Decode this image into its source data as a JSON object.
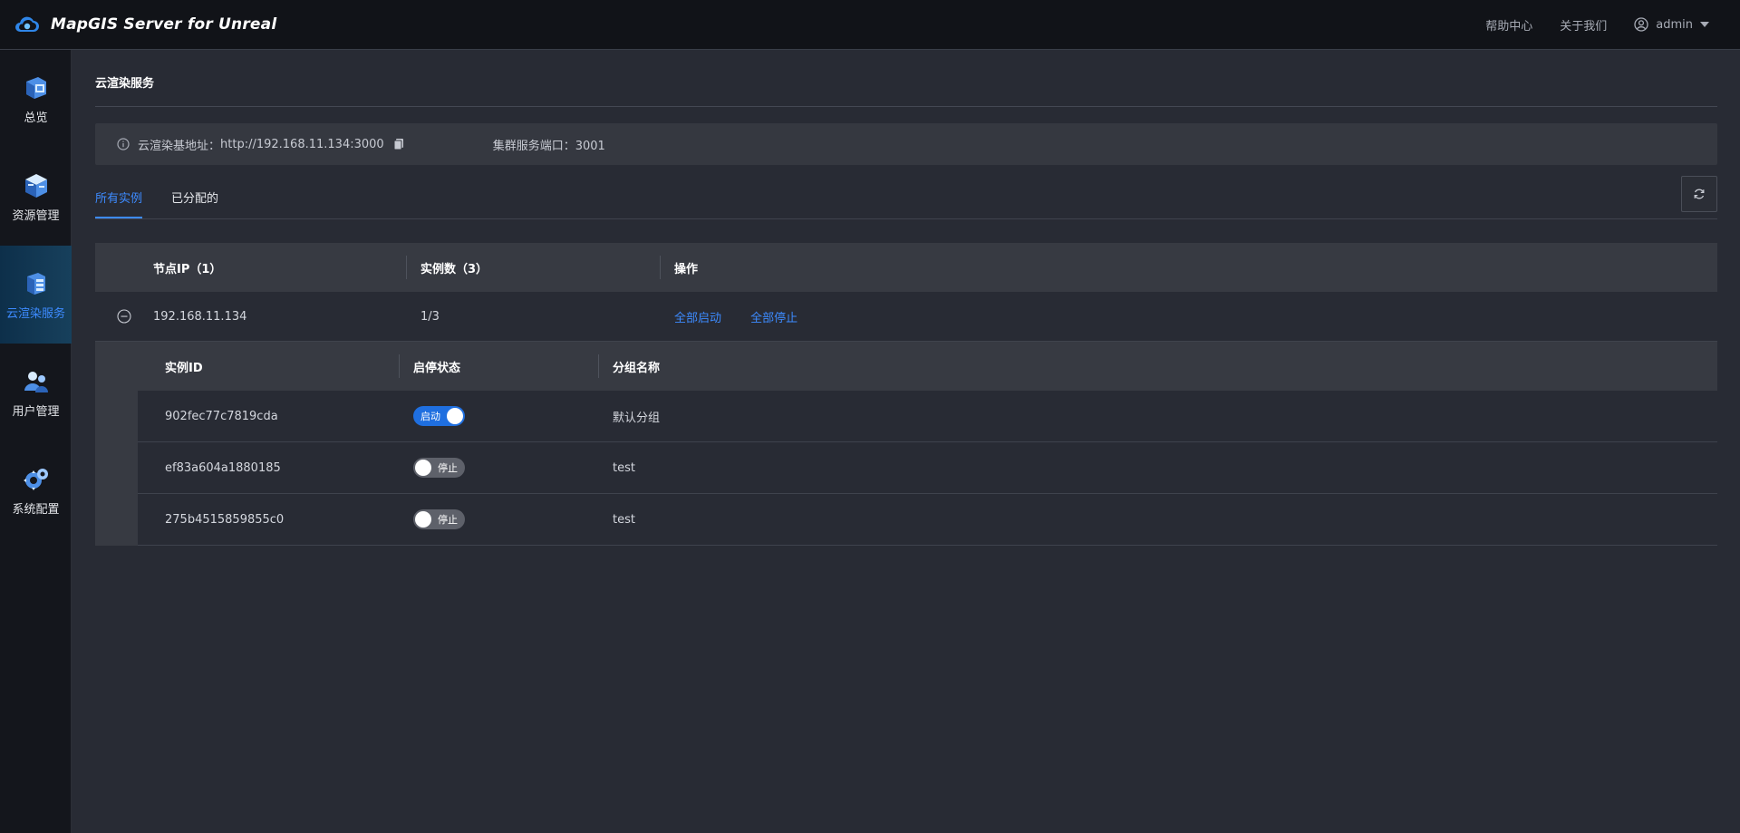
{
  "header": {
    "app_title": "MapGIS Server for Unreal",
    "links": [
      "帮助中心",
      "关于我们"
    ],
    "user": "admin"
  },
  "sidebar": {
    "items": [
      {
        "label": "总览",
        "icon": "overview-icon"
      },
      {
        "label": "资源管理",
        "icon": "resource-icon"
      },
      {
        "label": "云渲染服务",
        "icon": "cloud-render-icon",
        "active": true
      },
      {
        "label": "用户管理",
        "icon": "user-management-icon"
      },
      {
        "label": "系统配置",
        "icon": "system-config-icon"
      }
    ]
  },
  "page": {
    "title": "云渲染服务",
    "base_address_label": "云渲染基地址：",
    "base_address": "http://192.168.11.134:3000",
    "cluster_port_label": "集群服务端口：",
    "cluster_port": "3001"
  },
  "tabs": [
    {
      "label": "所有实例",
      "active": true
    },
    {
      "label": "已分配的",
      "active": false
    }
  ],
  "table": {
    "headers": {
      "node_ip": "节点IP（1）",
      "instance_count": "实例数（3）",
      "actions": "操作"
    },
    "node": {
      "ip": "192.168.11.134",
      "instances": "1/3",
      "start_all": "全部启动",
      "stop_all": "全部停止"
    },
    "sub_headers": {
      "instance_id": "实例ID",
      "status": "启停状态",
      "group_name": "分组名称"
    },
    "instances": [
      {
        "id": "902fec77c7819cda",
        "status": "启动",
        "on": true,
        "group": "默认分组"
      },
      {
        "id": "ef83a604a1880185",
        "status": "停止",
        "on": false,
        "group": "test"
      },
      {
        "id": "275b4515859855c0",
        "status": "停止",
        "on": false,
        "group": "test"
      }
    ]
  },
  "colors": {
    "accent": "#3d8bff",
    "switch_on": "#1f6fe0",
    "switch_off": "#5e616a",
    "background": "#282b34"
  }
}
